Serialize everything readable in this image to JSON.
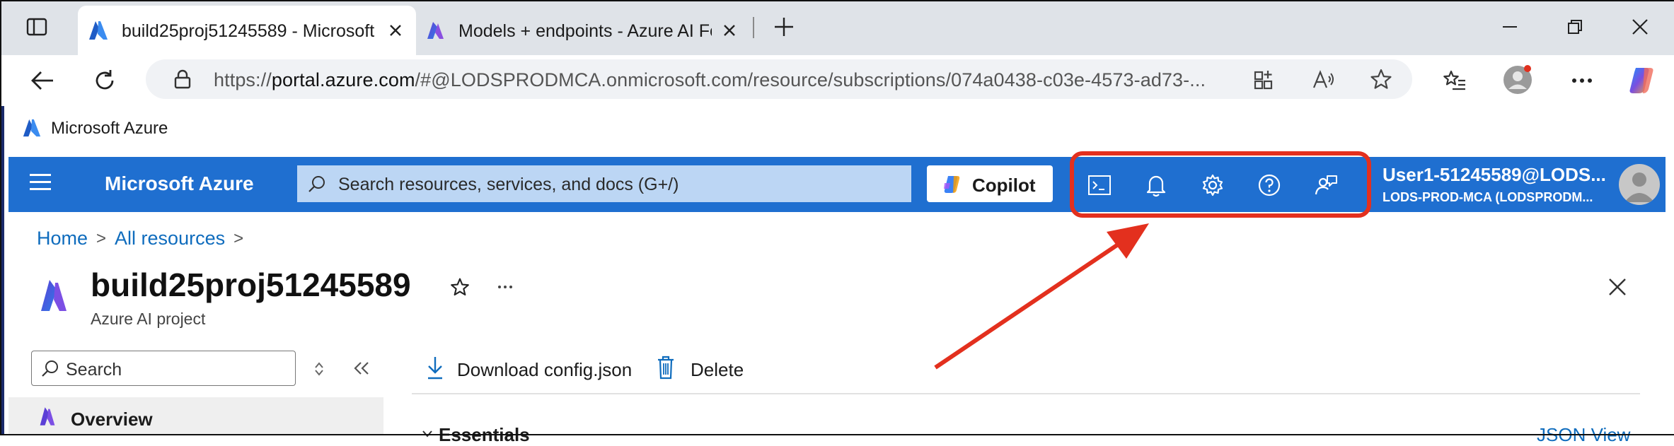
{
  "browser": {
    "tabs": [
      {
        "title": "build25proj51245589 - Microsoft",
        "active": true
      },
      {
        "title": "Models + endpoints - Azure AI Fo",
        "active": false
      }
    ],
    "address": {
      "prefix": "https://",
      "host": "portal.azure.com",
      "path": "/#@LODSPRODMCA.onmicrosoft.com/resource/subscriptions/074a0438-c03e-4573-ad73-..."
    },
    "favorites": [
      {
        "label": "Microsoft Azure"
      }
    ]
  },
  "azure_header": {
    "brand": "Microsoft Azure",
    "search_placeholder": "Search resources, services, and docs (G+/)",
    "copilot_label": "Copilot",
    "icons": [
      "cloud-shell-icon",
      "notifications-icon",
      "settings-icon",
      "help-icon",
      "feedback-icon"
    ],
    "user_name": "User1-51245589@LODS...",
    "user_tenant": "LODS-PROD-MCA (LODSPRODM..."
  },
  "breadcrumb": [
    "Home",
    "All resources"
  ],
  "resource": {
    "title": "build25proj51245589",
    "subtitle": "Azure AI project"
  },
  "sidebar": {
    "search_placeholder": "Search",
    "items": [
      {
        "label": "Overview"
      }
    ]
  },
  "commands": {
    "download": "Download config.json",
    "delete": "Delete"
  },
  "main": {
    "section": "Essentials",
    "json_view": "JSON View"
  },
  "colors": {
    "azure_blue": "#1f6fd0",
    "annotation_red": "#e3301e",
    "link_blue": "#0f6cbd"
  }
}
